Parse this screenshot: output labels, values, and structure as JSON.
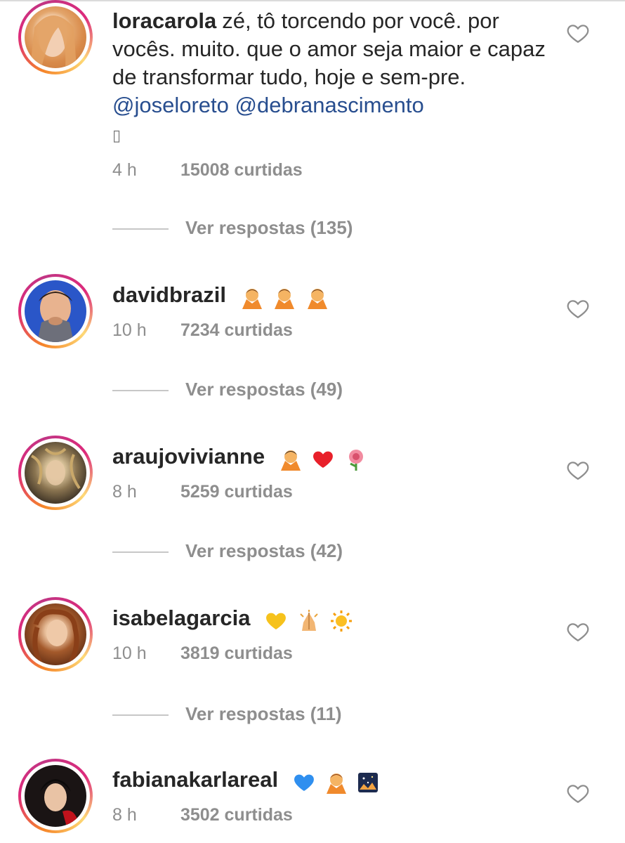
{
  "comments": [
    {
      "username": "loracarola",
      "text": "zé, tô torcendo por você. por vocês. muito. que o amor seja maior e capaz de transformar tudo, hoje e sem-pre.",
      "mentions": "@joseloreto @debranascimento",
      "tofu": "▯",
      "time": "4 h",
      "likes": "15008 curtidas",
      "replies": "Ver respostas (135)"
    },
    {
      "username": "davidbrazil",
      "emojis": [
        "person-gesturing-no-emoji",
        "person-gesturing-no-emoji",
        "person-gesturing-no-emoji"
      ],
      "time": "10 h",
      "likes": "7234 curtidas",
      "replies": "Ver respostas (49)"
    },
    {
      "username": "araujovivianne",
      "emojis": [
        "person-gesturing-no-emoji",
        "red-heart-emoji",
        "rose-emoji"
      ],
      "time": "8 h",
      "likes": "5259 curtidas",
      "replies": "Ver respostas (42)"
    },
    {
      "username": "isabelagarcia",
      "emojis": [
        "yellow-heart-emoji",
        "praying-hands-emoji",
        "sun-emoji"
      ],
      "time": "10 h",
      "likes": "3819 curtidas",
      "replies": "Ver respostas (11)"
    },
    {
      "username": "fabianakarlareal",
      "emojis": [
        "blue-heart-emoji",
        "person-gesturing-no-emoji",
        "night-sky-emoji"
      ],
      "time": "8 h",
      "likes": "3502 curtidas"
    }
  ],
  "colors": {
    "mention": "#284e8f",
    "meta": "#8e8e8e",
    "text": "#262626"
  }
}
